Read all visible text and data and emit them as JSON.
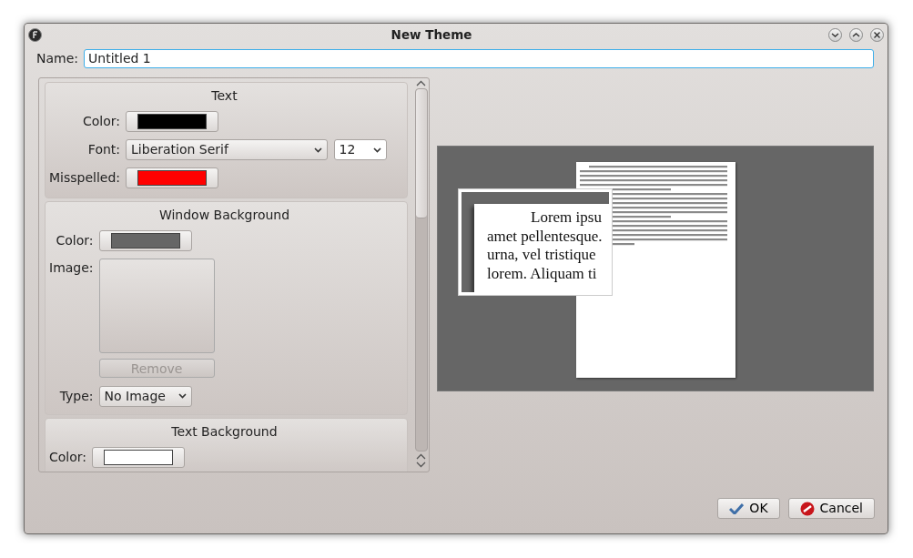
{
  "window": {
    "title": "New Theme"
  },
  "name_field": {
    "label": "Name:",
    "value": "Untitled 1"
  },
  "sections": [
    {
      "title": "Text",
      "rows": [
        {
          "kind": "color",
          "label": "Color:",
          "color": "#000000"
        },
        {
          "kind": "font",
          "label": "Font:",
          "value": "Liberation Serif",
          "size": "12"
        },
        {
          "kind": "color",
          "label": "Misspelled:",
          "color": "#ff0000"
        }
      ]
    },
    {
      "title": "Window Background",
      "rows": [
        {
          "kind": "color",
          "label": "Color:",
          "color": "#666666"
        },
        {
          "kind": "image",
          "label": "Image:",
          "button": "Remove",
          "disabled": true
        },
        {
          "kind": "select",
          "label": "Type:",
          "value": "No Image"
        }
      ]
    },
    {
      "title": "Text Background",
      "rows": [
        {
          "kind": "color",
          "label": "Color:",
          "color": "#ffffff"
        }
      ]
    }
  ],
  "preview": {
    "zoom_lines": [
      "Lorem ipsu",
      "amet pellentesque.",
      "urna, vel tristique",
      "lorem. Aliquam ti"
    ]
  },
  "buttons": [
    {
      "kind": "ok",
      "label": "OK"
    },
    {
      "kind": "cancel",
      "label": "Cancel"
    }
  ]
}
